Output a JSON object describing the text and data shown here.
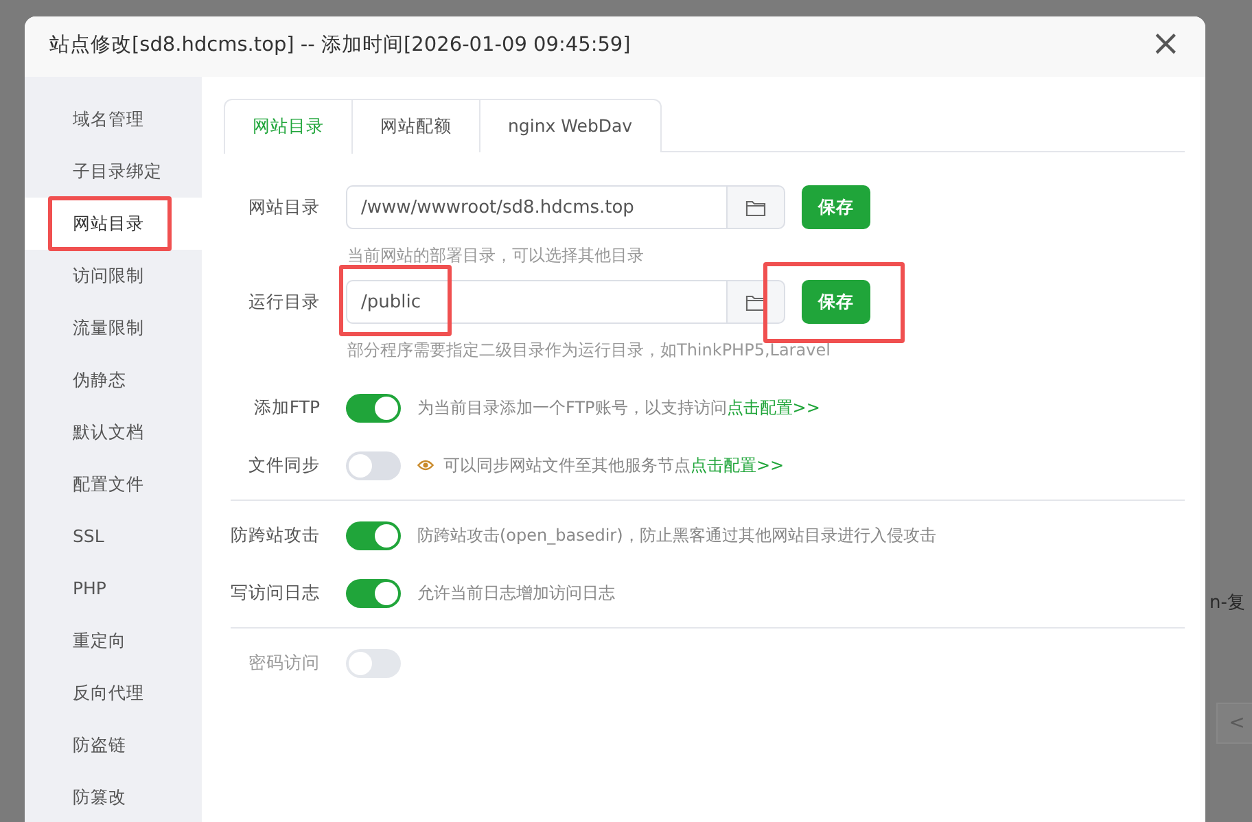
{
  "background": {
    "fragment_text": "n-复",
    "pager_button": "<"
  },
  "window": {
    "title": "站点修改[sd8.hdcms.top] -- 添加时间[2026-01-09 09:45:59]",
    "close": "×"
  },
  "sidebar": {
    "items": [
      {
        "label": "域名管理",
        "selected": false,
        "highlighted": false
      },
      {
        "label": "子目录绑定",
        "selected": false,
        "highlighted": false
      },
      {
        "label": "网站目录",
        "selected": true,
        "highlighted": true
      },
      {
        "label": "访问限制",
        "selected": false,
        "highlighted": false
      },
      {
        "label": "流量限制",
        "selected": false,
        "highlighted": false
      },
      {
        "label": "伪静态",
        "selected": false,
        "highlighted": false
      },
      {
        "label": "默认文档",
        "selected": false,
        "highlighted": false
      },
      {
        "label": "配置文件",
        "selected": false,
        "highlighted": false
      },
      {
        "label": "SSL",
        "selected": false,
        "highlighted": false
      },
      {
        "label": "PHP",
        "selected": false,
        "highlighted": false
      },
      {
        "label": "重定向",
        "selected": false,
        "highlighted": false
      },
      {
        "label": "反向代理",
        "selected": false,
        "highlighted": false
      },
      {
        "label": "防盗链",
        "selected": false,
        "highlighted": false
      },
      {
        "label": "防篡改",
        "selected": false,
        "highlighted": false
      }
    ]
  },
  "tabs": [
    {
      "label": "网站目录",
      "selected": true
    },
    {
      "label": "网站配额",
      "selected": false
    },
    {
      "label": "nginx WebDav",
      "selected": false
    }
  ],
  "dir_rows": [
    {
      "label": "网站目录",
      "value": "/www/wwwroot/sd8.hdcms.top",
      "button": "保存",
      "hint": "当前网站的部署目录，可以选择其他目录"
    },
    {
      "label": "运行目录",
      "value": "/public",
      "button": "保存",
      "hint": "部分程序需要指定二级目录作为运行目录，如ThinkPHP5,Laravel",
      "highlight_field": true,
      "highlight_button": true
    }
  ],
  "switch_groups": [
    [
      {
        "label": "添加FTP",
        "on": true,
        "description": "为当前目录添加一个FTP账号，以支持访问",
        "link": "点击配置>>"
      },
      {
        "label": "文件同步",
        "on": false,
        "warn_icon": true,
        "description": "可以同步网站文件至其他服务节点",
        "link": "点击配置>>"
      }
    ],
    [
      {
        "label": "防跨站攻击",
        "on": true,
        "description": "防跨站攻击(open_basedir)，防止黑客通过其他网站目录进行入侵攻击"
      },
      {
        "label": "写访问日志",
        "on": true,
        "description": "允许当前日志增加访问日志"
      }
    ],
    [
      {
        "label": "密码访问",
        "on": false,
        "disabled": true
      }
    ]
  ]
}
